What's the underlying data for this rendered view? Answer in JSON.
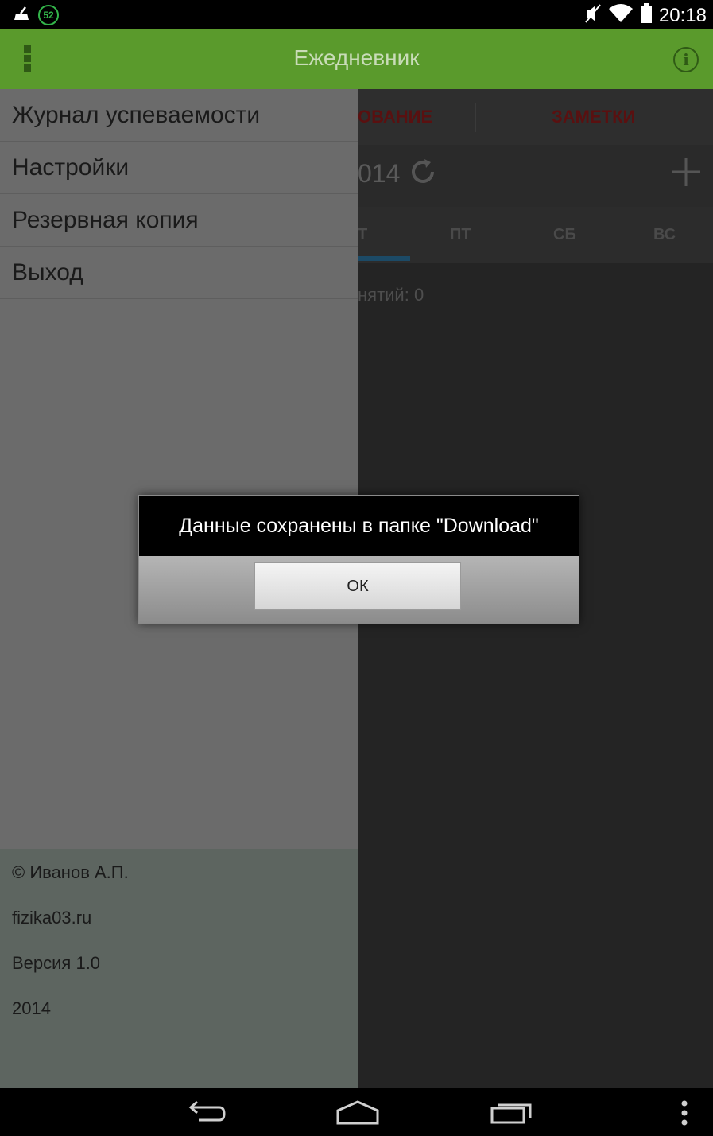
{
  "status_bar": {
    "notification_count": "52",
    "time": "20:18",
    "icons": [
      "cleaner-icon",
      "notification-badge-icon",
      "mute-icon",
      "wifi-icon",
      "battery-icon"
    ]
  },
  "action_bar": {
    "title": "Ежедневник",
    "menu_icon": "overflow-vertical-icon",
    "info_icon": "info-icon",
    "color": "#5a9a2c"
  },
  "background": {
    "tabs": [
      "ОВАНИЕ",
      "ЗАМЕТКИ"
    ],
    "date_partial": "014",
    "days": [
      "Т",
      "ПТ",
      "СБ",
      "ВС"
    ],
    "lessons_count_text": "нятий: 0"
  },
  "drawer": {
    "items": [
      {
        "label": "Журнал успеваемости"
      },
      {
        "label": "Настройки"
      },
      {
        "label": "Резервная копия"
      },
      {
        "label": "Выход"
      }
    ],
    "footer": {
      "author": "© Иванов А.П.",
      "site": "fizika03.ru",
      "version": "Версия 1.0",
      "year": "2014"
    }
  },
  "dialog": {
    "message": "Данные сохранены в папке \"Download\"",
    "ok_label": "ОК"
  },
  "nav_bar": {
    "icons": [
      "back-icon",
      "home-icon",
      "recents-icon",
      "overflow-menu-icon"
    ]
  }
}
